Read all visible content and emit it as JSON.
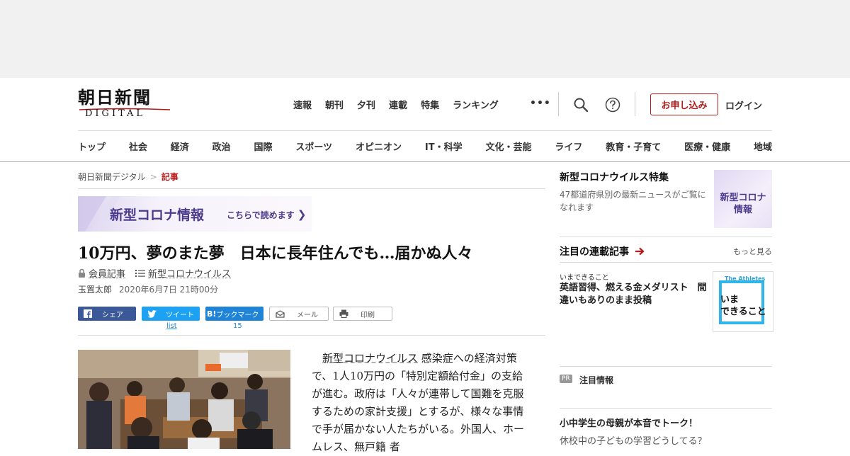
{
  "logo": {
    "jp": "朝日新聞",
    "en": "DIGITAL"
  },
  "global_nav": [
    "速報",
    "朝刊",
    "夕刊",
    "連載",
    "特集",
    "ランキング"
  ],
  "more_dots": "•••",
  "header_buttons": {
    "apply": "お申し込み",
    "login": "ログイン"
  },
  "category_nav": [
    "トップ",
    "社会",
    "経済",
    "政治",
    "国際",
    "スポーツ",
    "オピニオン",
    "IT・科学",
    "文化・芸能",
    "ライフ",
    "教育・子育て",
    "医療・健康",
    "地域"
  ],
  "breadcrumb": {
    "home": "朝日新聞デジタル",
    "sep": ">",
    "current": "記事"
  },
  "banner": {
    "title": "新型コロナ情報",
    "cta": "こちらで読めます"
  },
  "article": {
    "title": "10万円、夢のまた夢　日本に長年住んでも…届かぬ人々",
    "member_label": "会員記事",
    "topic_label": "新型コロナウイルス",
    "author": "玉置太郎",
    "date": "2020年6月7日 21時00分",
    "body_keyword": "新型コロナウイルス",
    "body_line1_rest": "感染症への経済対",
    "body_rest": "策で、1人10万円の「特別定額給付金」の支給が進む。政府は「人々が連帯して国難を克服するための家計支援」とするが、様々な事情で手が届かない人たちがいる。外国人、ホームレス、無戸籍 者"
  },
  "share": {
    "facebook": "シェア",
    "twitter": "ツイート",
    "twitter_count": "list",
    "hatena": "ブックマーク",
    "hatena_icon": "B!",
    "hatena_count": "15",
    "mail": "メール",
    "print": "印刷"
  },
  "sidebar": {
    "corona_title": "新型コロナウイルス特集",
    "corona_desc": "47都道府県別の最新ニュースがご覧になれます",
    "corona_thumb_line1": "新型コロナ",
    "corona_thumb_line2": "情報",
    "series_head": "注目の連載記事",
    "series_more": "もっと見る",
    "series_label": "いまできること",
    "series_title": "英語習得、燃える金メダリスト　間違いもありのまま投稿",
    "series_thumb_top": "The Athletes",
    "series_thumb_line1": "いま",
    "series_thumb_line2": "できること",
    "pr_badge": "PR",
    "pr_label": "注目情報",
    "pr_title": "小中学生の母親が本音でトーク！",
    "pr_sub": "休校中の子どもの学習どうしてる？"
  },
  "colors": {
    "accent": "#b31a1a",
    "corona_purple": "#4a3b8c",
    "facebook": "#3b5998",
    "twitter": "#1da1f2",
    "hatena": "#1f84d8"
  }
}
